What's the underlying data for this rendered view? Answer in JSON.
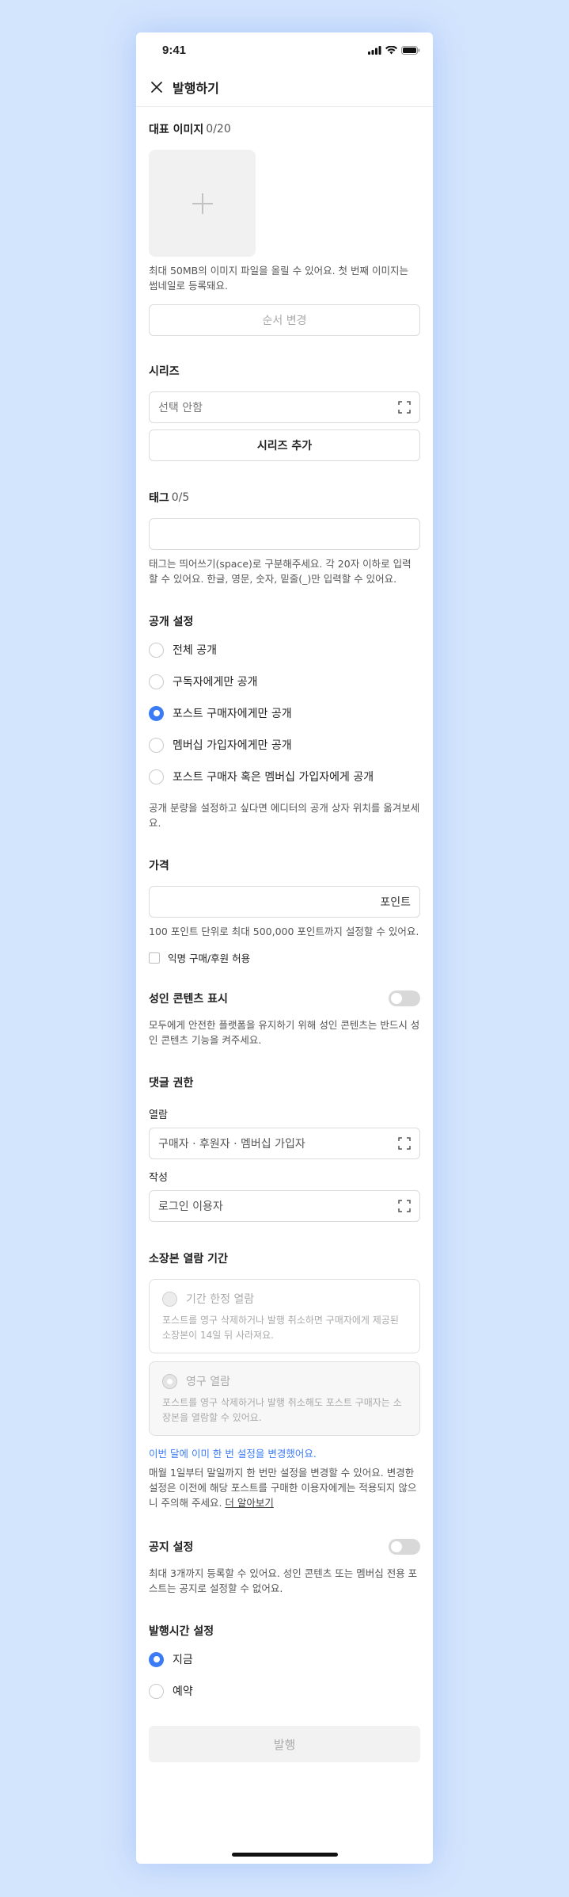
{
  "status_bar": {
    "time": "9:41"
  },
  "header": {
    "title": "발행하기"
  },
  "cover_image": {
    "title": "대표 이미지",
    "count": "0/20",
    "help": "최대 50MB의 이미지 파일을 올릴 수 있어요. 첫 번째 이미지는 썸네일로 등록돼요.",
    "reorder_label": "순서 변경"
  },
  "series": {
    "title": "시리즈",
    "select_value": "선택 안함",
    "add_label": "시리즈 추가"
  },
  "tags": {
    "title": "태그",
    "count": "0/5",
    "input_value": "",
    "help": "태그는 띄어쓰기(space)로 구분해주세요. 각 20자 이하로 입력할 수 있어요. 한글, 영문, 숫자, 밑줄(_)만 입력할 수 있어요."
  },
  "visibility": {
    "title": "공개 설정",
    "options": [
      {
        "label": "전체 공개",
        "selected": false
      },
      {
        "label": "구독자에게만 공개",
        "selected": false
      },
      {
        "label": "포스트 구매자에게만 공개",
        "selected": true
      },
      {
        "label": "멤버십 가입자에게만 공개",
        "selected": false
      },
      {
        "label": "포스트 구매자 혹은 멤버십 가입자에게 공개",
        "selected": false
      }
    ],
    "help": "공개 분량을 설정하고 싶다면 에디터의 공개 상자 위치를 옮겨보세요."
  },
  "price": {
    "title": "가격",
    "unit": "포인트",
    "help": "100 포인트 단위로 최대 500,000 포인트까지 설정할 수 있어요.",
    "anonymous_label": "익명 구매/후원 허용"
  },
  "adult": {
    "title": "성인 콘텐츠 표시",
    "help": "모두에게 안전한 플랫폼을 유지하기 위해 성인 콘텐츠는 반드시 성인 콘텐츠 기능을 켜주세요."
  },
  "comments": {
    "title": "댓글 권한",
    "read_label": "열람",
    "read_value": "구매자 · 후원자 · 멤버십 가입자",
    "write_label": "작성",
    "write_value": "로그인 이용자"
  },
  "archive": {
    "title": "소장본 열람 기간",
    "options": [
      {
        "label": "기간 한정 열람",
        "desc": "포스트를 영구 삭제하거나 발행 취소하면 구매자에게 제공된 소장본이 14일 뒤 사라져요."
      },
      {
        "label": "영구 열람",
        "desc": "포스트를 영구 삭제하거나 발행 취소해도 포스트 구매자는 소장본을 열람할 수 있어요."
      }
    ],
    "notice": "이번 달에 이미 한 번 설정을 변경했어요.",
    "help": "매월 1일부터 말일까지 한 번만 설정을 변경할 수 있어요. 변경한 설정은 이전에 해당 포스트를 구매한 이용자에게는 적용되지 않으니 주의해 주세요.",
    "learn_more": "더 알아보기"
  },
  "notice_setting": {
    "title": "공지 설정",
    "help": "최대 3개까지 등록할 수 있어요. 성인 콘텐츠 또는 멤버십 전용 포스트는 공지로 설정할 수 없어요."
  },
  "publish_time": {
    "title": "발행시간 설정",
    "options": [
      {
        "label": "지금",
        "selected": true
      },
      {
        "label": "예약",
        "selected": false
      }
    ]
  },
  "publish_button": {
    "label": "발행"
  },
  "colors": {
    "accent": "#3b7cf6",
    "background": "#d3e4fd"
  }
}
